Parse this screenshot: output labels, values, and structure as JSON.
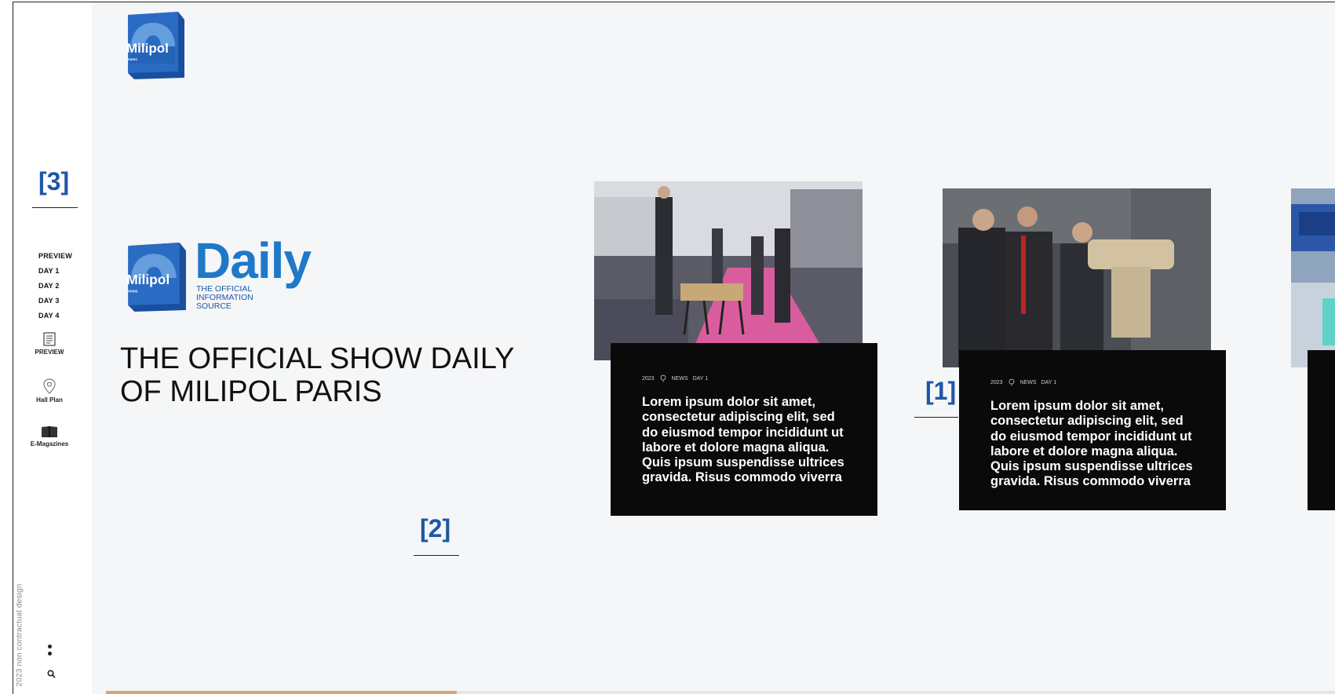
{
  "watermark": "2023 non contractual design",
  "annotations": [
    "[1]",
    "[2]",
    "[3]"
  ],
  "sidebar": {
    "text_items": [
      "PREVIEW",
      "DAY 1",
      "DAY 2",
      "DAY 3",
      "DAY 4"
    ],
    "icon_items": [
      {
        "label": "PREVIEW",
        "icon": "newspaper-icon"
      },
      {
        "label": "Hall Plan",
        "icon": "map-pin-icon"
      },
      {
        "label": "E-Magazines",
        "icon": "open-book-icon"
      }
    ],
    "bottom_icons": [
      "more-vertical-icon",
      "search-icon"
    ]
  },
  "brand": {
    "logo_text": "Milipol",
    "logo_subtext": "PARIS",
    "daily_word": "Daily",
    "tagline": "THE OFFICIAL INFORMATION SOURCE",
    "accent": "#1f78c8",
    "dark_blue": "#1f57a4"
  },
  "hero": {
    "headline_line1": "THE OFFICIAL SHOW DAILY",
    "headline_line2": "OF MILIPOL PARIS"
  },
  "cards": [
    {
      "year": "2023",
      "category": "NEWS",
      "day": "DAY 1",
      "text": "Lorem ipsum dolor sit amet, consectetur adipiscing elit, sed do eiusmod tempor incididunt ut labore et dolore magna aliqua. Quis ipsum suspendisse ultrices gravida. Risus commodo viverra"
    },
    {
      "year": "2023",
      "category": "NEWS",
      "day": "DAY 1",
      "text": "Lorem ipsum dolor sit amet, consectetur adipiscing elit, sed do eiusmod tempor incididunt ut labore et dolore magna aliqua. Quis ipsum suspendisse ultrices gravida. Risus commodo viverra"
    }
  ],
  "progress": {
    "fraction": 0.285,
    "color": "#d4a876"
  }
}
